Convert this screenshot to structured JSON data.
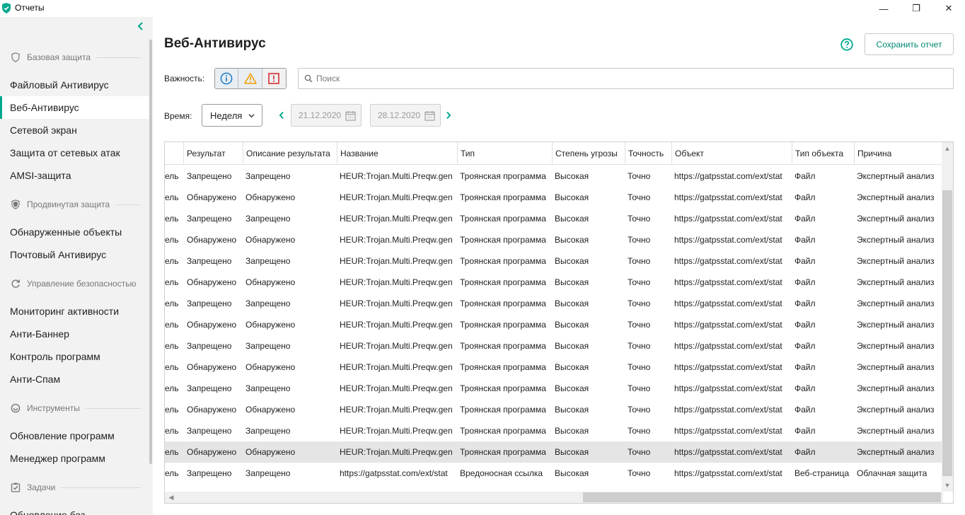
{
  "window": {
    "title": "Отчеты",
    "minimize": "—",
    "maximize": "❐",
    "close": "✕"
  },
  "sidebar": {
    "sections": [
      {
        "label": "Базовая защита",
        "icon": "shield-outline-icon"
      },
      {
        "label": "Продвинутая защита",
        "icon": "shield-filled-icon"
      },
      {
        "label": "Управление безопасностью",
        "icon": "refresh-shield-icon"
      },
      {
        "label": "Инструменты",
        "icon": "tools-icon"
      },
      {
        "label": "Задачи",
        "icon": "tasks-icon"
      }
    ],
    "items": [
      {
        "label": "Файловый Антивирус"
      },
      {
        "label": "Веб-Антивирус",
        "active": true
      },
      {
        "label": "Сетевой экран"
      },
      {
        "label": "Защита от сетевых атак"
      },
      {
        "label": "AMSI-защита"
      },
      {
        "label": "Обнаруженные объекты"
      },
      {
        "label": "Почтовый Антивирус"
      },
      {
        "label": "Мониторинг активности"
      },
      {
        "label": "Анти-Баннер"
      },
      {
        "label": "Контроль программ"
      },
      {
        "label": "Анти-Спам"
      },
      {
        "label": "Обновление программ"
      },
      {
        "label": "Менеджер программ"
      },
      {
        "label": "Обновление баз"
      }
    ]
  },
  "main": {
    "title": "Веб-Антивирус",
    "save_label": "Сохранить отчет",
    "severity_label": "Важность:",
    "search_placeholder": "Поиск",
    "time_label": "Время:",
    "period_value": "Неделя",
    "date_from": "21.12.2020",
    "date_to": "28.12.2020"
  },
  "colors": {
    "accent": "#00a88e",
    "info": "#1a78c2",
    "warning": "#f0a30a",
    "critical": "#d32f2f"
  },
  "table": {
    "columns": [
      "Результат",
      "Описание результата",
      "Название",
      "Тип",
      "Степень угрозы",
      "Точность",
      "Объект",
      "Тип объекта",
      "Причина"
    ],
    "rows": [
      [
        "ель",
        "Запрещено",
        "Запрещено",
        "HEUR:Trojan.Multi.Preqw.gen",
        "Троянская программа",
        "Высокая",
        "Точно",
        "https://gatpsstat.com/ext/stat",
        "Файл",
        "Экспертный анализ"
      ],
      [
        "ель",
        "Обнаружено",
        "Обнаружено",
        "HEUR:Trojan.Multi.Preqw.gen",
        "Троянская программа",
        "Высокая",
        "Точно",
        "https://gatpsstat.com/ext/stat",
        "Файл",
        "Экспертный анализ"
      ],
      [
        "ель",
        "Запрещено",
        "Запрещено",
        "HEUR:Trojan.Multi.Preqw.gen",
        "Троянская программа",
        "Высокая",
        "Точно",
        "https://gatpsstat.com/ext/stat",
        "Файл",
        "Экспертный анализ"
      ],
      [
        "ель",
        "Обнаружено",
        "Обнаружено",
        "HEUR:Trojan.Multi.Preqw.gen",
        "Троянская программа",
        "Высокая",
        "Точно",
        "https://gatpsstat.com/ext/stat",
        "Файл",
        "Экспертный анализ"
      ],
      [
        "ель",
        "Запрещено",
        "Запрещено",
        "HEUR:Trojan.Multi.Preqw.gen",
        "Троянская программа",
        "Высокая",
        "Точно",
        "https://gatpsstat.com/ext/stat",
        "Файл",
        "Экспертный анализ"
      ],
      [
        "ель",
        "Обнаружено",
        "Обнаружено",
        "HEUR:Trojan.Multi.Preqw.gen",
        "Троянская программа",
        "Высокая",
        "Точно",
        "https://gatpsstat.com/ext/stat",
        "Файл",
        "Экспертный анализ"
      ],
      [
        "ель",
        "Запрещено",
        "Запрещено",
        "HEUR:Trojan.Multi.Preqw.gen",
        "Троянская программа",
        "Высокая",
        "Точно",
        "https://gatpsstat.com/ext/stat",
        "Файл",
        "Экспертный анализ"
      ],
      [
        "ель",
        "Обнаружено",
        "Обнаружено",
        "HEUR:Trojan.Multi.Preqw.gen",
        "Троянская программа",
        "Высокая",
        "Точно",
        "https://gatpsstat.com/ext/stat",
        "Файл",
        "Экспертный анализ"
      ],
      [
        "ель",
        "Запрещено",
        "Запрещено",
        "HEUR:Trojan.Multi.Preqw.gen",
        "Троянская программа",
        "Высокая",
        "Точно",
        "https://gatpsstat.com/ext/stat",
        "Файл",
        "Экспертный анализ"
      ],
      [
        "ель",
        "Обнаружено",
        "Обнаружено",
        "HEUR:Trojan.Multi.Preqw.gen",
        "Троянская программа",
        "Высокая",
        "Точно",
        "https://gatpsstat.com/ext/stat",
        "Файл",
        "Экспертный анализ"
      ],
      [
        "ель",
        "Запрещено",
        "Запрещено",
        "HEUR:Trojan.Multi.Preqw.gen",
        "Троянская программа",
        "Высокая",
        "Точно",
        "https://gatpsstat.com/ext/stat",
        "Файл",
        "Экспертный анализ"
      ],
      [
        "ель",
        "Обнаружено",
        "Обнаружено",
        "HEUR:Trojan.Multi.Preqw.gen",
        "Троянская программа",
        "Высокая",
        "Точно",
        "https://gatpsstat.com/ext/stat",
        "Файл",
        "Экспертный анализ"
      ],
      [
        "ель",
        "Запрещено",
        "Запрещено",
        "HEUR:Trojan.Multi.Preqw.gen",
        "Троянская программа",
        "Высокая",
        "Точно",
        "https://gatpsstat.com/ext/stat",
        "Файл",
        "Экспертный анализ"
      ],
      [
        "ель",
        "Обнаружено",
        "Обнаружено",
        "HEUR:Trojan.Multi.Preqw.gen",
        "Троянская программа",
        "Высокая",
        "Точно",
        "https://gatpsstat.com/ext/stat",
        "Файл",
        "Экспертный анализ"
      ],
      [
        "ель",
        "Запрещено",
        "Запрещено",
        "https://gatpsstat.com/ext/stat",
        "Вредоносная ссылка",
        "Высокая",
        "Точно",
        "https://gatpsstat.com/ext/stat",
        "Веб-страница",
        "Облачная защита"
      ]
    ],
    "selected_row": 13
  }
}
